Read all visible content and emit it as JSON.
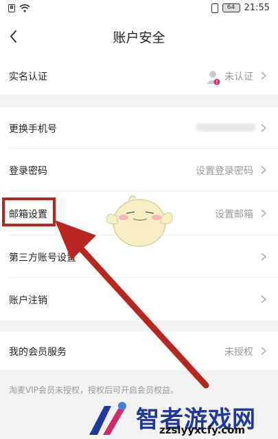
{
  "status_bar": {
    "time": "21:55",
    "battery": "64",
    "sim_icon": "sim-b-icon",
    "wifi_icon": "wifi-icon",
    "vibrate_icon": "vibrate-icon"
  },
  "header": {
    "title": "账户安全",
    "back_icon": "back-icon"
  },
  "rows": [
    {
      "label": "实名认证",
      "value": "未认证"
    },
    {
      "label": "更换手机号",
      "value": ""
    },
    {
      "label": "登录密码",
      "value": "设置登录密码"
    },
    {
      "label": "邮箱设置",
      "value": "设置邮箱"
    },
    {
      "label": "第三方账号设置",
      "value": ""
    },
    {
      "label": "账户注销",
      "value": ""
    },
    {
      "label": "我的会员服务",
      "value": "未授权"
    }
  ],
  "footer_note": "淘麦VIP会员未授权，授权后可开启会员权益。",
  "watermark": {
    "brand": "智者游戏网",
    "url": "zzslyyxcfy.com"
  },
  "colors": {
    "annotation_red": "#b8271f",
    "watermark_blue": "#1d3a9a"
  }
}
